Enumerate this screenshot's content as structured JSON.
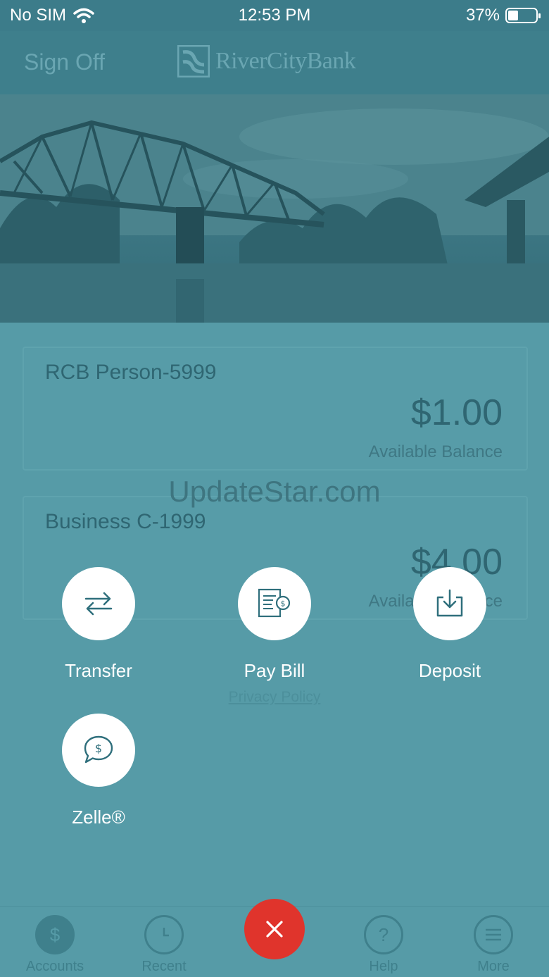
{
  "status_bar": {
    "carrier": "No SIM",
    "time": "12:53 PM",
    "battery_percent": "37%",
    "battery_level": 0.37
  },
  "header": {
    "sign_off": "Sign Off",
    "logo_text": "RiverCityBank"
  },
  "accounts": [
    {
      "name": "RCB Person-5999",
      "amount": "$1.00",
      "balance_label": "Available Balance"
    },
    {
      "name": "Business C-1999",
      "amount": "$4.00",
      "balance_label": "Available Balance"
    }
  ],
  "privacy_policy": "Privacy Policy",
  "watermark": "UpdateStar.com",
  "actions": {
    "transfer": "Transfer",
    "pay_bill": "Pay Bill",
    "deposit": "Deposit",
    "zelle": "Zelle®"
  },
  "tabs": {
    "accounts": "Accounts",
    "recent": "Recent",
    "help": "Help",
    "more": "More"
  },
  "colors": {
    "header": "#3e7f8c",
    "overlay": "#569ba7",
    "close_button": "#e0342c"
  }
}
